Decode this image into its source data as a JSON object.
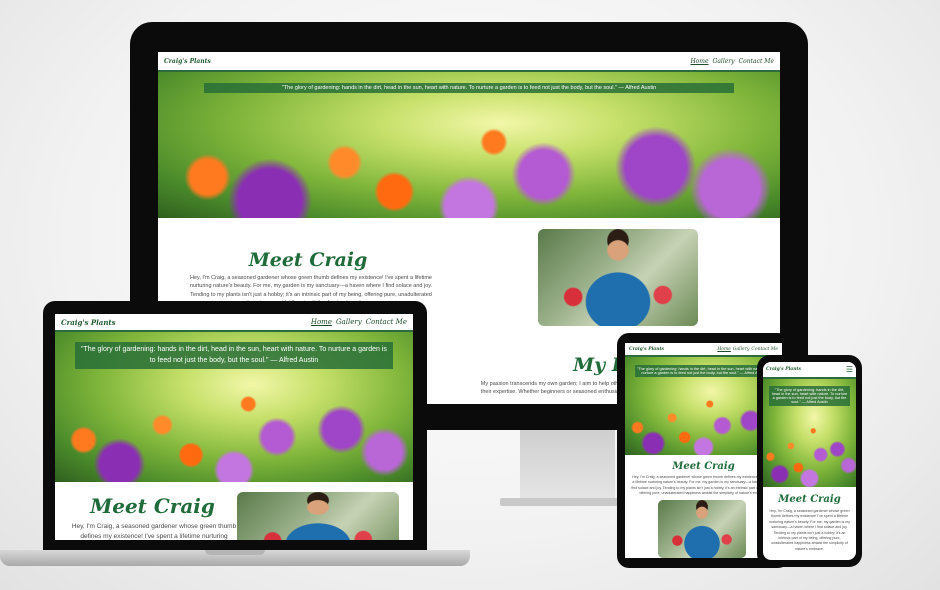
{
  "site": {
    "brand": "Craig's Plants",
    "nav": [
      {
        "label": "Home",
        "active": true
      },
      {
        "label": "Gallery",
        "active": false
      },
      {
        "label": "Contact Me",
        "active": false
      }
    ],
    "quote": "\"The glory of gardening: hands in the dirt, head in the sun, heart with nature. To nurture a garden is to feed not just the body, but the soul.\" — Alfred Austin",
    "meet_heading": "Meet Craig",
    "meet_text": "Hey, I'm Craig, a seasoned gardener whose green thumb defines my existence! I've spent a lifetime nurturing nature's beauty. For me, my garden is my sanctuary—a haven where I find solace and joy. Tending to my plants isn't just a hobby; it's an intrinsic part of my being, offering pure, unadulterated happiness amidst the simplicity of nature's embrace.",
    "passion_heading": "My Passion",
    "passion_text": "My passion transcends my own garden; I aim to help others discover the joy of gardening regardless of their expertise. Whether beginners or seasoned enthusiasts, my goal is simple: unveil the enchantment"
  },
  "colors": {
    "brand_green": "#1f6b3a",
    "quote_bg": "#286e37"
  }
}
